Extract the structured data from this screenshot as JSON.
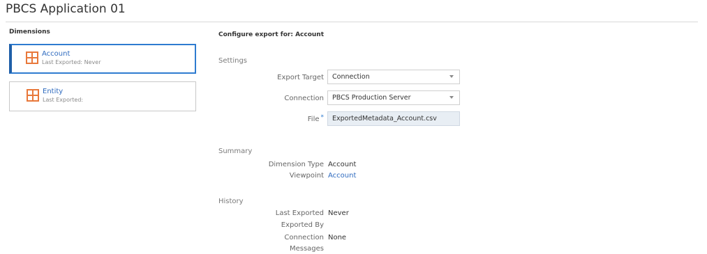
{
  "app": {
    "title": "PBCS Application 01"
  },
  "sidebar": {
    "heading": "Dimensions",
    "items": [
      {
        "name": "Account",
        "subtitle": "Last Exported: Never",
        "selected": true
      },
      {
        "name": "Entity",
        "subtitle": "Last Exported:",
        "selected": false
      }
    ],
    "icon": "grid-icon",
    "icon_color": "#e8783a",
    "accent_color": "#2e7bd0"
  },
  "config": {
    "heading": "Configure export for: Account",
    "settings": {
      "label": "Settings",
      "export_target": {
        "label": "Export Target",
        "value": "Connection"
      },
      "connection": {
        "label": "Connection",
        "value": "PBCS Production Server"
      },
      "file": {
        "label": "File",
        "required_mark": "*",
        "value": "ExportedMetadata_Account.csv"
      }
    },
    "summary": {
      "label": "Summary",
      "dimension_type": {
        "label": "Dimension Type",
        "value": "Account"
      },
      "viewpoint": {
        "label": "Viewpoint",
        "value": "Account"
      }
    },
    "history": {
      "label": "History",
      "last_exported": {
        "label": "Last Exported",
        "value": "Never"
      },
      "exported_by": {
        "label": "Exported By",
        "value": ""
      },
      "connection": {
        "label": "Connection",
        "value": "None"
      },
      "messages": {
        "label": "Messages",
        "value": ""
      }
    }
  }
}
